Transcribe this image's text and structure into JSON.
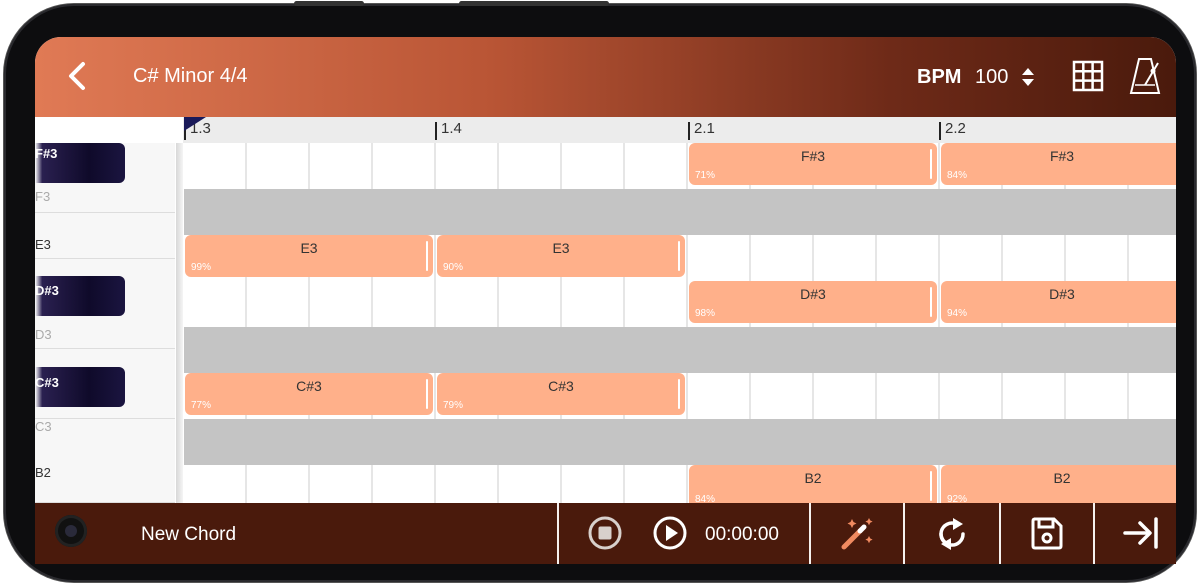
{
  "header": {
    "title": "C# Minor 4/4",
    "bpm_label": "BPM",
    "bpm_value": "100"
  },
  "ruler": {
    "marks": [
      "1.3",
      "1.4",
      "2.1",
      "2.2"
    ]
  },
  "keys": [
    {
      "label": "F#3",
      "type": "black"
    },
    {
      "label": "F3",
      "type": "white"
    },
    {
      "label": "E3",
      "type": "white"
    },
    {
      "label": "D#3",
      "type": "black"
    },
    {
      "label": "D3",
      "type": "white"
    },
    {
      "label": "C#3",
      "type": "black"
    },
    {
      "label": "C3",
      "type": "white"
    },
    {
      "label": "B2",
      "type": "white"
    }
  ],
  "notes": [
    {
      "label": "F#3",
      "pct": "71%"
    },
    {
      "label": "F#3",
      "pct": "84%"
    },
    {
      "label": "E3",
      "pct": "99%"
    },
    {
      "label": "E3",
      "pct": "90%"
    },
    {
      "label": "D#3",
      "pct": "98%"
    },
    {
      "label": "D#3",
      "pct": "94%"
    },
    {
      "label": "C#3",
      "pct": "77%"
    },
    {
      "label": "C#3",
      "pct": "79%"
    },
    {
      "label": "B2",
      "pct": "84%"
    },
    {
      "label": "B2",
      "pct": "92%"
    }
  ],
  "bottom": {
    "new_chord": "New Chord",
    "time": "00:00:00"
  },
  "colors": {
    "header_start": "#e07a55",
    "header_end": "#4a1a0c",
    "note_fill": "#ffb08a",
    "bottom_bar": "#4a1a0c",
    "accent_icon": "#f08a60"
  },
  "icons": [
    "back-arrow-icon",
    "spinner-arrows-icon",
    "grid-icon",
    "metronome-icon",
    "stop-icon",
    "play-icon",
    "magic-wand-icon",
    "refresh-icon",
    "save-icon",
    "export-icon"
  ]
}
